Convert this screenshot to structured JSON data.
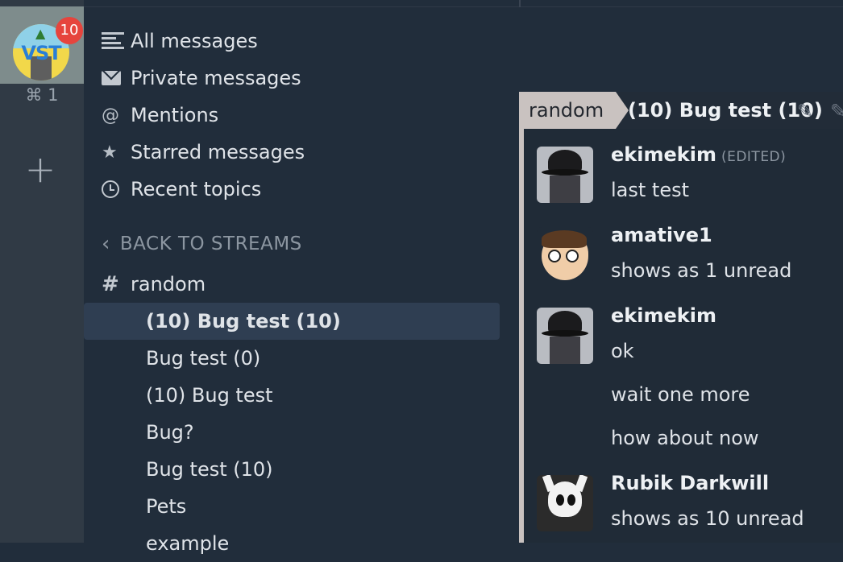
{
  "org": {
    "logo_text": "VST",
    "unread_badge": "10",
    "shortcut": "⌘ 1",
    "add_label": "+"
  },
  "nav": {
    "items": [
      {
        "label": "All messages",
        "icon": "all-messages-icon"
      },
      {
        "label": "Private messages",
        "icon": "envelope-icon"
      },
      {
        "label": "Mentions",
        "icon": "at-icon"
      },
      {
        "label": "Starred messages",
        "icon": "star-icon"
      },
      {
        "label": "Recent topics",
        "icon": "clock-icon"
      }
    ],
    "at_glyph": "@",
    "star_glyph": "★"
  },
  "streams": {
    "back_label": "BACK TO STREAMS",
    "back_glyph": "‹",
    "hash": "#",
    "current_stream": "random",
    "topics": [
      {
        "label": "(10) Bug test (10)",
        "active": true
      },
      {
        "label": "Bug test (0)"
      },
      {
        "label": "(10) Bug test"
      },
      {
        "label": "Bug?"
      },
      {
        "label": "Bug test (10)"
      },
      {
        "label": "Pets"
      },
      {
        "label": "example"
      }
    ]
  },
  "recipient": {
    "stream": "random",
    "topic": "(10) Bug test (10)",
    "edit_glyph": "✎",
    "mute_glyph": "✎"
  },
  "messages": [
    {
      "sender": "ekimekim",
      "edited": "(EDITED)",
      "content": "last test"
    },
    {
      "sender": "amative1",
      "content": "shows as 1 unread"
    },
    {
      "sender": "ekimekim",
      "content": "ok"
    },
    {
      "content": "wait one more"
    },
    {
      "content": "how about now"
    },
    {
      "sender": "Rubik Darkwill",
      "content": "shows as 10 unread"
    }
  ],
  "colors": {
    "background": "#212d3b",
    "rail": "#303a45",
    "active_topic_bg": "#2f3e52",
    "stream_label_bg": "#c9c2c0",
    "badge": "#e6443d"
  }
}
